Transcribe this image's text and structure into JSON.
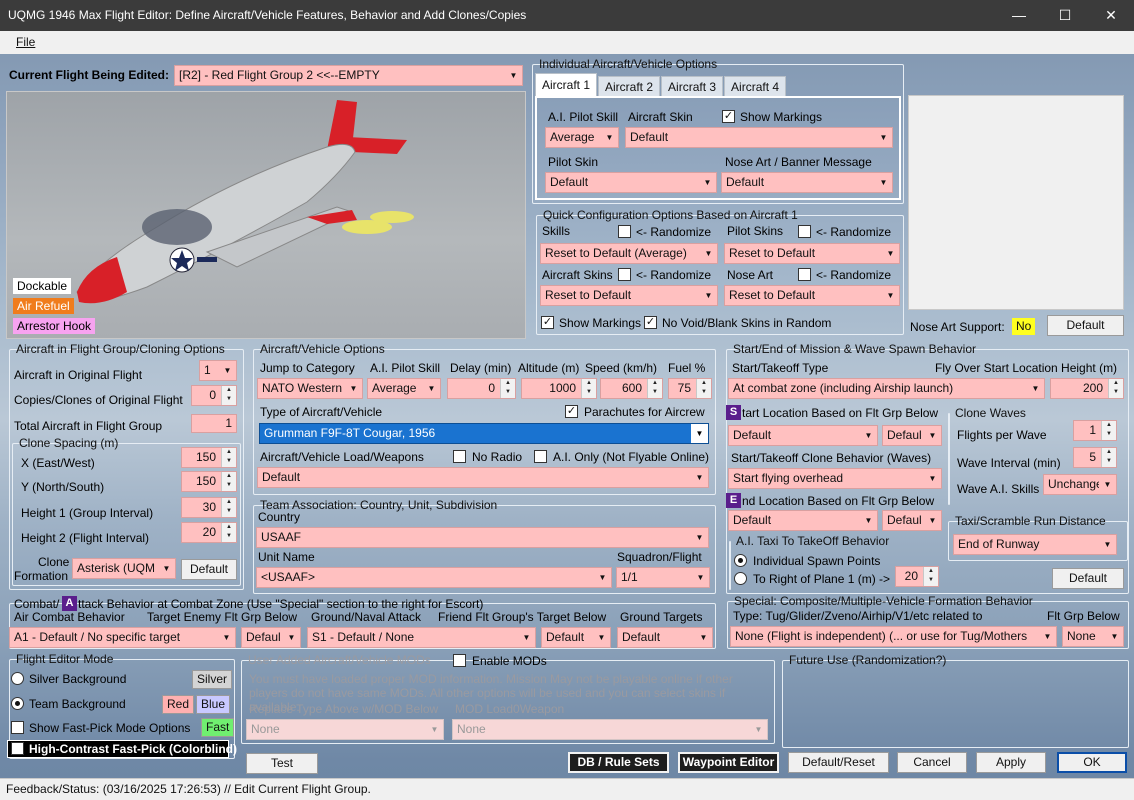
{
  "window": {
    "title": "UQMG 1946 Max Flight Editor:  Define Aircraft/Vehicle Features, Behavior and Add Clones/Copies",
    "minimize": "—",
    "maximize": "☐",
    "close": "✕"
  },
  "menu": {
    "file": "File"
  },
  "flight": {
    "label": "Current Flight Being Edited:",
    "value": "[R2] -  Red Flight Group  2     <<--EMPTY"
  },
  "preview_tags": {
    "dockable": "Dockable",
    "air_refuel": "Air Refuel",
    "arrestor": "Arrestor Hook"
  },
  "individual": {
    "title": "Individual Aircraft/Vehicle Options",
    "tabs": [
      "Aircraft 1",
      "Aircraft 2",
      "Aircraft 3",
      "Aircraft 4"
    ],
    "pilot_skill_label": "A.I. Pilot Skill",
    "pilot_skill": "Average",
    "aircraft_skin_label": "Aircraft Skin",
    "aircraft_skin": "Default",
    "show_markings": "Show Markings",
    "pilot_skin_label": "Pilot Skin",
    "pilot_skin": "Default",
    "nose_art_label": "Nose Art / Banner Message",
    "nose_art": "Default"
  },
  "quick": {
    "title": "Quick Configuration Options Based on Aircraft 1",
    "skills": "Skills",
    "randomize": "<- Randomize",
    "pilot_skins": "Pilot Skins",
    "reset_avg": "Reset to Default (Average)",
    "reset_default": "Reset to Default",
    "aircraft_skins": "Aircraft Skins",
    "nose_art": "Nose Art",
    "show_markings": "Show Markings",
    "no_void": "No Void/Blank Skins in Random"
  },
  "nose_support": {
    "label": "Nose Art Support:",
    "value": "No",
    "default_btn": "Default"
  },
  "cloning": {
    "title": "Aircraft in Flight Group/Cloning Options",
    "orig_label": "Aircraft in Original Flight",
    "orig": "1",
    "copies_label": "Copies/Clones of Original Flight",
    "copies": "0",
    "total_label": "Total Aircraft in Flight Group",
    "total": "1",
    "spacing_title": "Clone Spacing (m)",
    "x_label": "X (East/West)",
    "x": "150",
    "y_label": "Y (North/South)",
    "y": "150",
    "h1_label": "Height 1 (Group Interval)",
    "h1": "30",
    "h2_label": "Height 2 (Flight Interval)",
    "h2": "20",
    "formation_label1": "Clone",
    "formation_label2": "Formation",
    "formation": "Asterisk (UQM",
    "default_btn": "Default"
  },
  "vehicle": {
    "title": "Aircraft/Vehicle Options",
    "jump_label": "Jump to Category",
    "jump": "NATO Western",
    "skill_label": "A.I. Pilot Skill",
    "skill": "Average",
    "delay_label": "Delay (min)",
    "delay": "0",
    "alt_label": "Altitude (m)",
    "alt": "1000",
    "speed_label": "Speed (km/h)",
    "speed": "600",
    "fuel_label": "Fuel %",
    "fuel": "75",
    "type_label": "Type of Aircraft/Vehicle",
    "parachutes": "Parachutes for Aircrew",
    "type": "Grumman F9F-8T Cougar, 1956",
    "load_label": "Aircraft/Vehicle Load/Weapons",
    "no_radio": "No Radio",
    "ai_only": "A.I. Only (Not Flyable Online)",
    "load": "Default"
  },
  "team": {
    "title": "Team Association:  Country, Unit, Subdivision",
    "country_label": "Country",
    "country": "USAAF",
    "unit_label": "Unit Name",
    "unit": "<USAAF>",
    "squadron_label": "Squadron/Flight",
    "squadron": "1/1"
  },
  "spawn": {
    "title": "Start/End of Mission & Wave Spawn Behavior",
    "start_type_label": "Start/Takeoff Type",
    "fly_over_label": "Fly Over Start Location Height (m)",
    "start_type": "At combat zone (including Airship launch)",
    "fly_height": "200",
    "start_loc_label": "tart Location Based on Flt Grp Below",
    "start_loc": "Default",
    "start_loc2": "Defaul",
    "clone_behavior_label": "Start/Takeoff Clone Behavior (Waves)",
    "clone_behavior": "Start flying overhead",
    "end_loc_label": "nd Location Based on Flt Grp Below",
    "end_loc": "Default",
    "end_loc2": "Defaul",
    "taxi_title": "A.I. Taxi To TakeOff Behavior",
    "taxi_opt1": "Individual Spawn Points",
    "taxi_opt2": "To Right of Plane 1 (m) ->",
    "taxi_val": "20",
    "waves_title": "Clone Waves",
    "fpw_label": "Flights per Wave",
    "fpw": "1",
    "interval_label": "Wave Interval (min)",
    "interval": "5",
    "ai_skills_label": "Wave A.I. Skills",
    "ai_skills": "Unchange",
    "scramble_title": "Taxi/Scramble Run Distance",
    "scramble": "End of Runway",
    "default_btn": "Default",
    "badge_s": "S",
    "badge_e": "E"
  },
  "combat": {
    "title": "Combat/",
    "title2": "ttack Behavior at Combat Zone (Use \"Special\" section to the right for Escort)",
    "badge": "A",
    "air_label": "Air Combat Behavior",
    "air": "A1 - Default / No specific target",
    "enemy_label": "Target Enemy Flt Grp Below",
    "enemy": "Defaul",
    "ground_label": "Ground/Naval Attack",
    "ground": "S1 - Default / None",
    "friend_label": "Friend Flt Group's Target Below",
    "friend": "Default",
    "targets_label": "Ground Targets",
    "targets": "Default"
  },
  "special": {
    "title": "Special: Composite/Multiple-Vehicle Formation Behavior",
    "type_label": "Type: Tug/Glider/Zveno/Airhip/V1/etc related to",
    "grp_label": "Flt Grp Below",
    "type": "None (Flight is independent) (... or use for Tug/Mothers",
    "grp": "None"
  },
  "mode": {
    "title": "Flight Editor Mode",
    "silver_bg": "Silver Background",
    "silver": "Silver",
    "team_bg": "Team Background",
    "red": "Red",
    "blue": "Blue",
    "fast_pick": "Show Fast-Pick Mode Options",
    "fast": "Fast",
    "high_contrast": "High-Contrast Fast-Pick (Colorblind)"
  },
  "mods": {
    "title": "User Added Aircraft/Vehicle MODs",
    "enable": "Enable MODs",
    "desc": "You must have loaded proper MOD information. Mission May not be playable online if other players do not have same MODs.  All other options will be used and you can select skins if available.",
    "replace_label": "Replace Type Above w/MOD Below",
    "loadout_label": "MOD Load0Weapon",
    "replace": "None",
    "loadout": "None"
  },
  "future": {
    "title": "Future Use (Randomization?)"
  },
  "buttons": {
    "test": "Test",
    "db": "DB / Rule Sets",
    "waypoint": "Waypoint Editor",
    "reset": "Default/Reset",
    "cancel": "Cancel",
    "apply": "Apply",
    "ok": "OK"
  },
  "status": {
    "text": "Feedback/Status:  (03/16/2025 17:26:53) // Edit Current Flight Group."
  }
}
